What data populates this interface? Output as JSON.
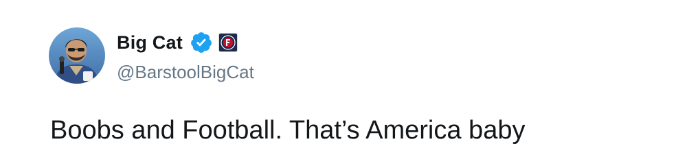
{
  "tweet": {
    "author": {
      "display_name": "Big Cat",
      "handle": "@BarstoolBigCat",
      "avatar_icon": "user-avatar",
      "verified_icon": "verified-badge-icon",
      "affiliate_icon": "barstool-badge-icon"
    },
    "text": "Boobs and Football. That’s America baby"
  },
  "colors": {
    "text": "#14171a",
    "handle": "#657786",
    "verified": "#1da1f2",
    "background": "#ffffff"
  }
}
